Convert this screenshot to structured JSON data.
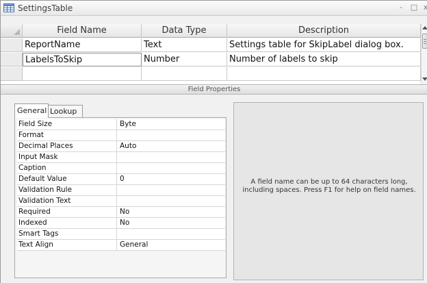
{
  "window": {
    "title": "SettingsTable",
    "controls": {
      "minimize": "-",
      "maximize": "□",
      "close": "x"
    }
  },
  "grid": {
    "columns": [
      "Field Name",
      "Data Type",
      "Description"
    ],
    "rows": [
      {
        "field_name": "ReportName",
        "data_type": "Text",
        "description": "Settings table for SkipLabel dialog box."
      },
      {
        "field_name": "LabelsToSkip",
        "data_type": "Number",
        "description": "Number of labels to skip"
      },
      {
        "field_name": "",
        "data_type": "",
        "description": ""
      }
    ]
  },
  "field_properties": {
    "header": "Field Properties",
    "tabs": [
      "General",
      "Lookup"
    ],
    "active_tab": "General",
    "rows": [
      {
        "name": "Field Size",
        "value": "Byte"
      },
      {
        "name": "Format",
        "value": ""
      },
      {
        "name": "Decimal Places",
        "value": "Auto"
      },
      {
        "name": "Input Mask",
        "value": ""
      },
      {
        "name": "Caption",
        "value": ""
      },
      {
        "name": "Default Value",
        "value": "0"
      },
      {
        "name": "Validation Rule",
        "value": ""
      },
      {
        "name": "Validation Text",
        "value": ""
      },
      {
        "name": "Required",
        "value": "No"
      },
      {
        "name": "Indexed",
        "value": "No"
      },
      {
        "name": "Smart Tags",
        "value": ""
      },
      {
        "name": "Text Align",
        "value": "General"
      }
    ],
    "help_text": "A field name can be up to 64 characters long, including spaces.  Press F1 for help on field names."
  },
  "icons": {
    "window_icon": "table-icon",
    "scroll_up": "scroll-up-arrow-icon",
    "scroll_down": "scroll-down-arrow-icon"
  }
}
